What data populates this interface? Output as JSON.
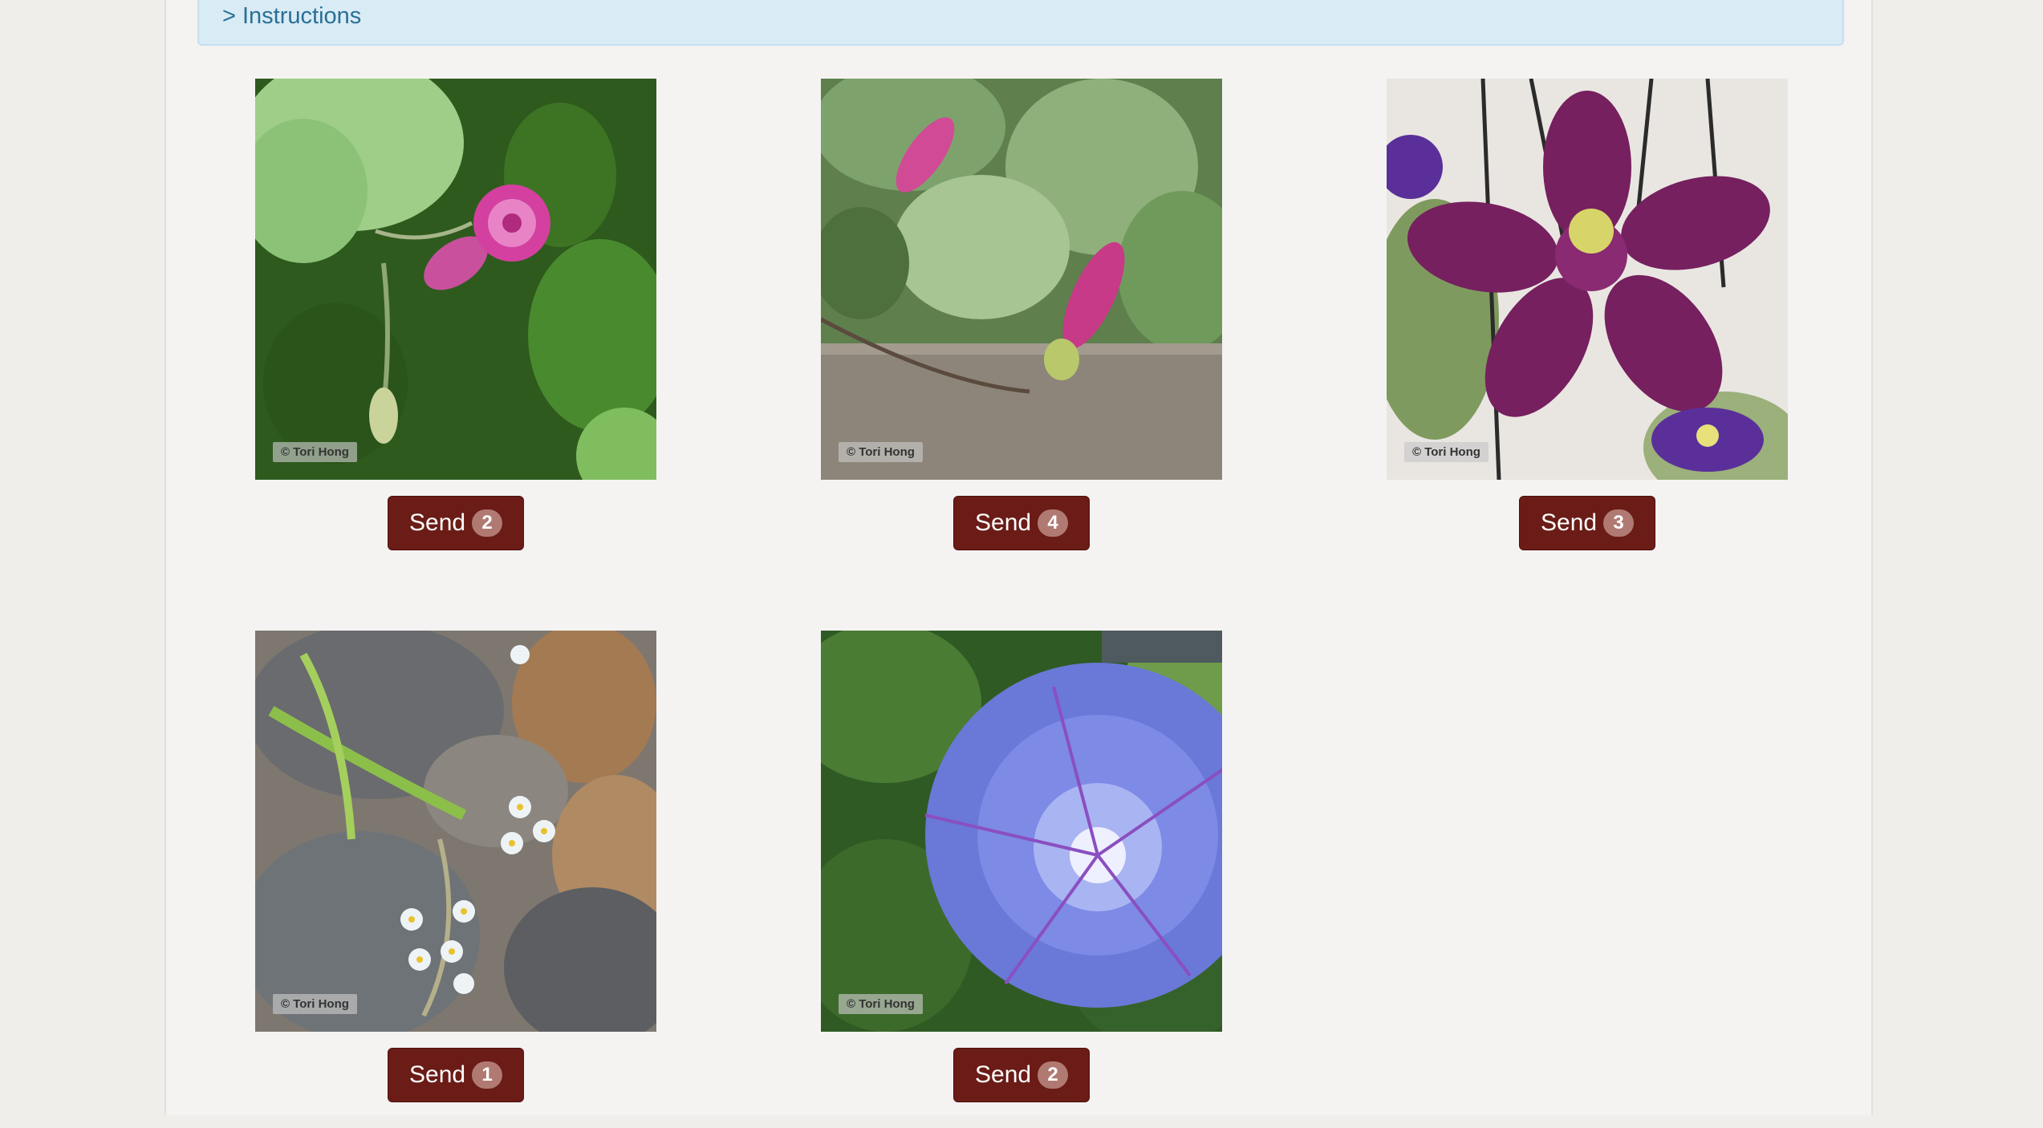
{
  "instructions": {
    "label": "> Instructions"
  },
  "cards": [
    {
      "watermark": "© Tori Hong",
      "send_label": "Send",
      "count": "2",
      "subject": "pink morning glory bud"
    },
    {
      "watermark": "© Tori Hong",
      "send_label": "Send",
      "count": "4",
      "subject": "pink morning glory buds on wood"
    },
    {
      "watermark": "© Tori Hong",
      "send_label": "Send",
      "count": "3",
      "subject": "purple clematis"
    },
    {
      "watermark": "© Tori Hong",
      "send_label": "Send",
      "count": "1",
      "subject": "white forget-me-nots on rocks"
    },
    {
      "watermark": "© Tori Hong",
      "send_label": "Send",
      "count": "2",
      "subject": "blue morning glory"
    }
  ],
  "colors": {
    "button": "#6b1c17",
    "badge": "#b07a73",
    "instructions_bg": "#d9ebf5",
    "instructions_text": "#2a6f96"
  }
}
